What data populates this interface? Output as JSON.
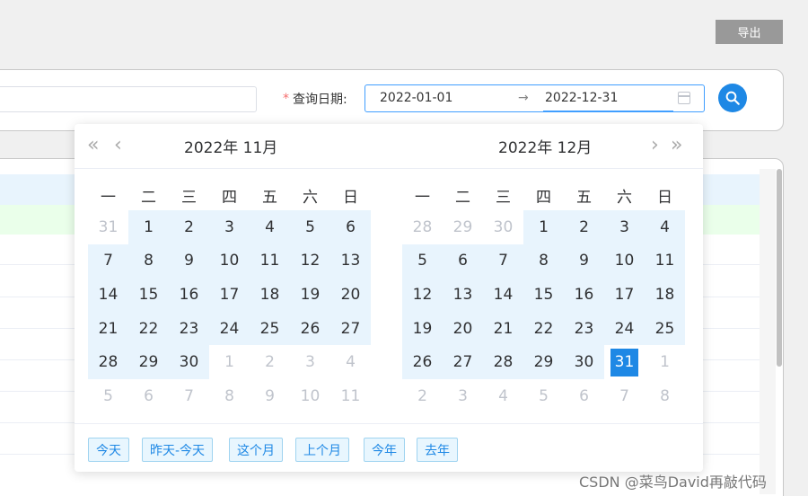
{
  "toolbar": {
    "export_label": "导出"
  },
  "query": {
    "date_label": "查询日期:",
    "required_mark": "*",
    "start_date": "2022-01-01",
    "separator": "→",
    "end_date": "2022-12-31"
  },
  "picker": {
    "weekdays": [
      "一",
      "二",
      "三",
      "四",
      "五",
      "六",
      "日"
    ],
    "left": {
      "title": "2022年  11月",
      "nav_prev_year": "«",
      "nav_prev_month": "‹",
      "days": [
        [
          {
            "d": "31",
            "t": "other"
          },
          {
            "d": "1",
            "t": "in"
          },
          {
            "d": "2",
            "t": "in"
          },
          {
            "d": "3",
            "t": "in"
          },
          {
            "d": "4",
            "t": "in"
          },
          {
            "d": "5",
            "t": "in"
          },
          {
            "d": "6",
            "t": "in"
          }
        ],
        [
          {
            "d": "7",
            "t": "in"
          },
          {
            "d": "8",
            "t": "in"
          },
          {
            "d": "9",
            "t": "in"
          },
          {
            "d": "10",
            "t": "in"
          },
          {
            "d": "11",
            "t": "in"
          },
          {
            "d": "12",
            "t": "in"
          },
          {
            "d": "13",
            "t": "in"
          }
        ],
        [
          {
            "d": "14",
            "t": "in"
          },
          {
            "d": "15",
            "t": "in"
          },
          {
            "d": "16",
            "t": "in"
          },
          {
            "d": "17",
            "t": "in"
          },
          {
            "d": "18",
            "t": "in"
          },
          {
            "d": "19",
            "t": "in"
          },
          {
            "d": "20",
            "t": "in"
          }
        ],
        [
          {
            "d": "21",
            "t": "in"
          },
          {
            "d": "22",
            "t": "in"
          },
          {
            "d": "23",
            "t": "in"
          },
          {
            "d": "24",
            "t": "in"
          },
          {
            "d": "25",
            "t": "in"
          },
          {
            "d": "26",
            "t": "in"
          },
          {
            "d": "27",
            "t": "in"
          }
        ],
        [
          {
            "d": "28",
            "t": "in"
          },
          {
            "d": "29",
            "t": "in"
          },
          {
            "d": "30",
            "t": "in"
          },
          {
            "d": "1",
            "t": "other"
          },
          {
            "d": "2",
            "t": "other"
          },
          {
            "d": "3",
            "t": "other"
          },
          {
            "d": "4",
            "t": "other"
          }
        ],
        [
          {
            "d": "5",
            "t": "other"
          },
          {
            "d": "6",
            "t": "other"
          },
          {
            "d": "7",
            "t": "other"
          },
          {
            "d": "8",
            "t": "other"
          },
          {
            "d": "9",
            "t": "other"
          },
          {
            "d": "10",
            "t": "other"
          },
          {
            "d": "11",
            "t": "other"
          }
        ]
      ]
    },
    "right": {
      "title": "2022年  12月",
      "nav_next_month": "›",
      "nav_next_year": "»",
      "days": [
        [
          {
            "d": "28",
            "t": "other"
          },
          {
            "d": "29",
            "t": "other"
          },
          {
            "d": "30",
            "t": "other"
          },
          {
            "d": "1",
            "t": "in"
          },
          {
            "d": "2",
            "t": "in"
          },
          {
            "d": "3",
            "t": "in"
          },
          {
            "d": "4",
            "t": "in"
          }
        ],
        [
          {
            "d": "5",
            "t": "in"
          },
          {
            "d": "6",
            "t": "in"
          },
          {
            "d": "7",
            "t": "in"
          },
          {
            "d": "8",
            "t": "in"
          },
          {
            "d": "9",
            "t": "in"
          },
          {
            "d": "10",
            "t": "in"
          },
          {
            "d": "11",
            "t": "in"
          }
        ],
        [
          {
            "d": "12",
            "t": "in"
          },
          {
            "d": "13",
            "t": "in"
          },
          {
            "d": "14",
            "t": "in"
          },
          {
            "d": "15",
            "t": "in"
          },
          {
            "d": "16",
            "t": "in"
          },
          {
            "d": "17",
            "t": "in"
          },
          {
            "d": "18",
            "t": "in"
          }
        ],
        [
          {
            "d": "19",
            "t": "in"
          },
          {
            "d": "20",
            "t": "in"
          },
          {
            "d": "21",
            "t": "in"
          },
          {
            "d": "22",
            "t": "in"
          },
          {
            "d": "23",
            "t": "in"
          },
          {
            "d": "24",
            "t": "in"
          },
          {
            "d": "25",
            "t": "in"
          }
        ],
        [
          {
            "d": "26",
            "t": "in"
          },
          {
            "d": "27",
            "t": "in"
          },
          {
            "d": "28",
            "t": "in"
          },
          {
            "d": "29",
            "t": "in"
          },
          {
            "d": "30",
            "t": "in"
          },
          {
            "d": "31",
            "t": "selected"
          },
          {
            "d": "1",
            "t": "other"
          }
        ],
        [
          {
            "d": "2",
            "t": "other"
          },
          {
            "d": "3",
            "t": "other"
          },
          {
            "d": "4",
            "t": "other"
          },
          {
            "d": "5",
            "t": "other"
          },
          {
            "d": "6",
            "t": "other"
          },
          {
            "d": "7",
            "t": "other"
          },
          {
            "d": "8",
            "t": "other"
          }
        ]
      ]
    },
    "shortcuts": [
      "今天",
      "昨天-今天",
      "这个月",
      "上个月",
      "今年",
      "去年"
    ]
  },
  "colors": {
    "accent": "#1e88e5",
    "range_bg": "#e8f4fd",
    "required": "#f56c6c"
  },
  "icons": {
    "search": "search-icon",
    "calendar": "calendar-icon"
  },
  "watermark": "CSDN @菜鸟David再敲代码"
}
